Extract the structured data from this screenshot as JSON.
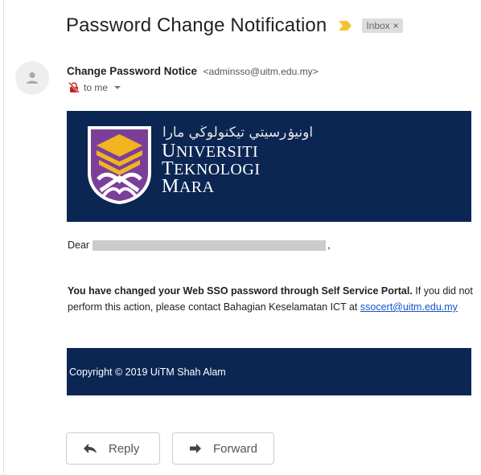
{
  "email": {
    "subject": "Password Change Notification",
    "label": "Inbox",
    "label_close": "×",
    "sender_name": "Change Password Notice",
    "sender_email": "<adminsso@uitm.edu.my>",
    "recipient": "to me"
  },
  "banner": {
    "jawi_name": "اونيۏرسيتي تيكنولوڬي مارا",
    "name_line1_initial": "U",
    "name_line1_rest": "NIVERSITI",
    "name_line2_initial": "T",
    "name_line2_rest": "EKNOLOGI",
    "name_line3_initial": "M",
    "name_line3_rest": "ARA"
  },
  "body": {
    "greeting": "Dear",
    "greeting_end": ",",
    "bold_sentence": "You have changed your Web SSO password through Self Service Portal.",
    "rest_sentence": " If you did not perform this action, please contact Bahagian Keselamatan ICT at ",
    "contact_link": "ssocert@uitm.edu.my",
    "footer": "Copyright © 2019 UiTM Shah Alam"
  },
  "actions": {
    "reply_label": "Reply",
    "forward_label": "Forward"
  },
  "icons": {
    "importance": "importance-marker-icon",
    "avatar": "person-icon",
    "encryption": "lock-off-icon",
    "reply": "reply-arrow-icon",
    "forward": "forward-arrow-icon"
  },
  "colors": {
    "banner_bg": "#0b2653",
    "importance": "#f4c430",
    "link": "#1155cc",
    "unencrypted": "#c5221f",
    "logo_purple": "#7b3f99",
    "logo_gold": "#f2b420"
  }
}
